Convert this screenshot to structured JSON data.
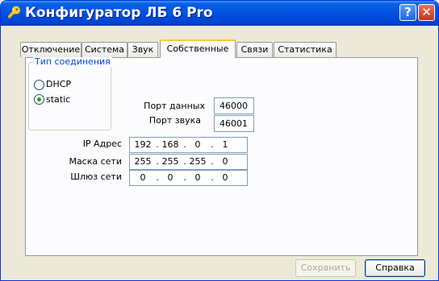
{
  "window": {
    "title": "Конфигуратор ЛБ 6 Pro",
    "help_label": "?",
    "close_label": "✕"
  },
  "tabs": [
    {
      "label": "Отключение"
    },
    {
      "label": "Система"
    },
    {
      "label": "Звук"
    },
    {
      "label": "Собственные",
      "active": true
    },
    {
      "label": "Связи"
    },
    {
      "label": "Статистика"
    }
  ],
  "connection": {
    "group_label": "Тип соединения",
    "options": [
      {
        "label": "DHCP",
        "checked": false
      },
      {
        "label": "static",
        "checked": true
      }
    ]
  },
  "ports": {
    "data_label": "Порт данных",
    "data_value": "46000",
    "sound_label": "Порт звука",
    "sound_value": "46001"
  },
  "network": {
    "ip_label": "IP Адрес",
    "ip": [
      "192",
      "168",
      "0",
      "1"
    ],
    "mask_label": "Маска сети",
    "mask": [
      "255",
      "255",
      "255",
      "0"
    ],
    "gateway_label": "Шлюз сети",
    "gateway": [
      "0",
      "0",
      "0",
      "0"
    ]
  },
  "buttons": {
    "save_label": "Сохранить",
    "help_label": "Справка"
  },
  "colors": {
    "titlebar": "#0053e3",
    "tab_highlight": "#ffc83c",
    "group_label": "#0046d5"
  }
}
